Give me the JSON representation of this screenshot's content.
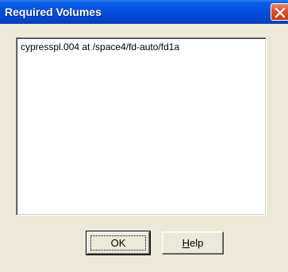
{
  "window": {
    "title": "Required Volumes",
    "close_icon": "close-icon"
  },
  "volumes": {
    "items": [
      "cypresspl.004 at /space4/fd-auto/fd1a"
    ]
  },
  "buttons": {
    "ok_label": "OK",
    "help_mnemonic": "H",
    "help_rest": "elp"
  },
  "colors": {
    "titlebar": "#0450de",
    "close_button": "#d9532e",
    "face": "#ece9d8"
  }
}
